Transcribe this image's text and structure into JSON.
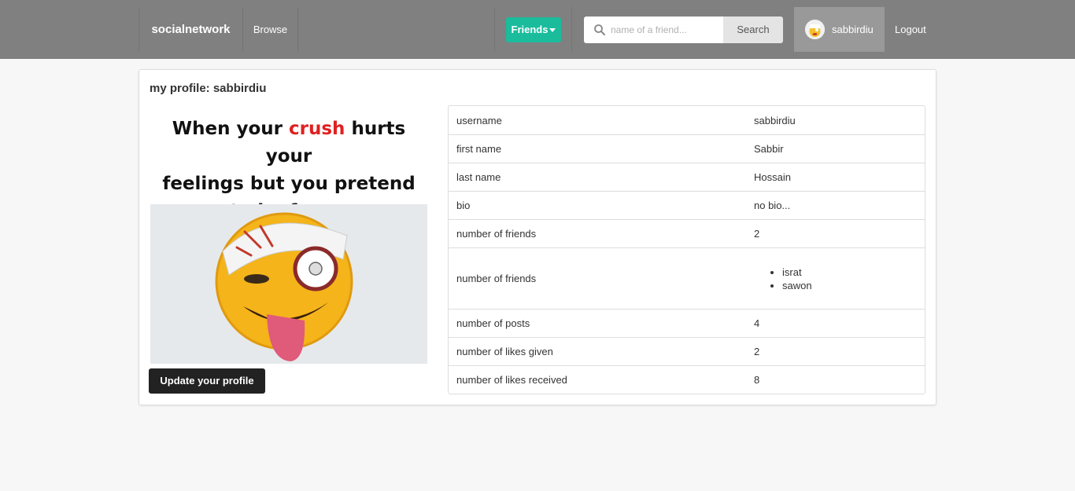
{
  "nav": {
    "brand": "socialnetwork",
    "browse": "Browse",
    "friends_label": "Friends",
    "search_placeholder": "name of a friend...",
    "search_button": "Search",
    "username": "sabbirdiu",
    "logout": "Logout",
    "accent_color": "#1abc9c"
  },
  "profile": {
    "title": "my profile: sabbirdiu",
    "meme": {
      "line1_a": "When your ",
      "line1_crush": "crush",
      "line1_b": " hurts your",
      "line2": "feelings but you pretend",
      "line3": "to be funny"
    },
    "update_button": "Update your profile",
    "rows": [
      {
        "key": "username",
        "value": "sabbirdiu"
      },
      {
        "key": "first name",
        "value": "Sabbir"
      },
      {
        "key": "last name",
        "value": "Hossain"
      },
      {
        "key": "bio",
        "value": "no bio..."
      },
      {
        "key": "number of friends",
        "value": "2"
      },
      {
        "key": "number of friends",
        "friends": [
          "israt",
          "sawon"
        ]
      },
      {
        "key": "number of posts",
        "value": "4"
      },
      {
        "key": "number of likes given",
        "value": "2"
      },
      {
        "key": "number of likes received",
        "value": "8"
      }
    ]
  }
}
